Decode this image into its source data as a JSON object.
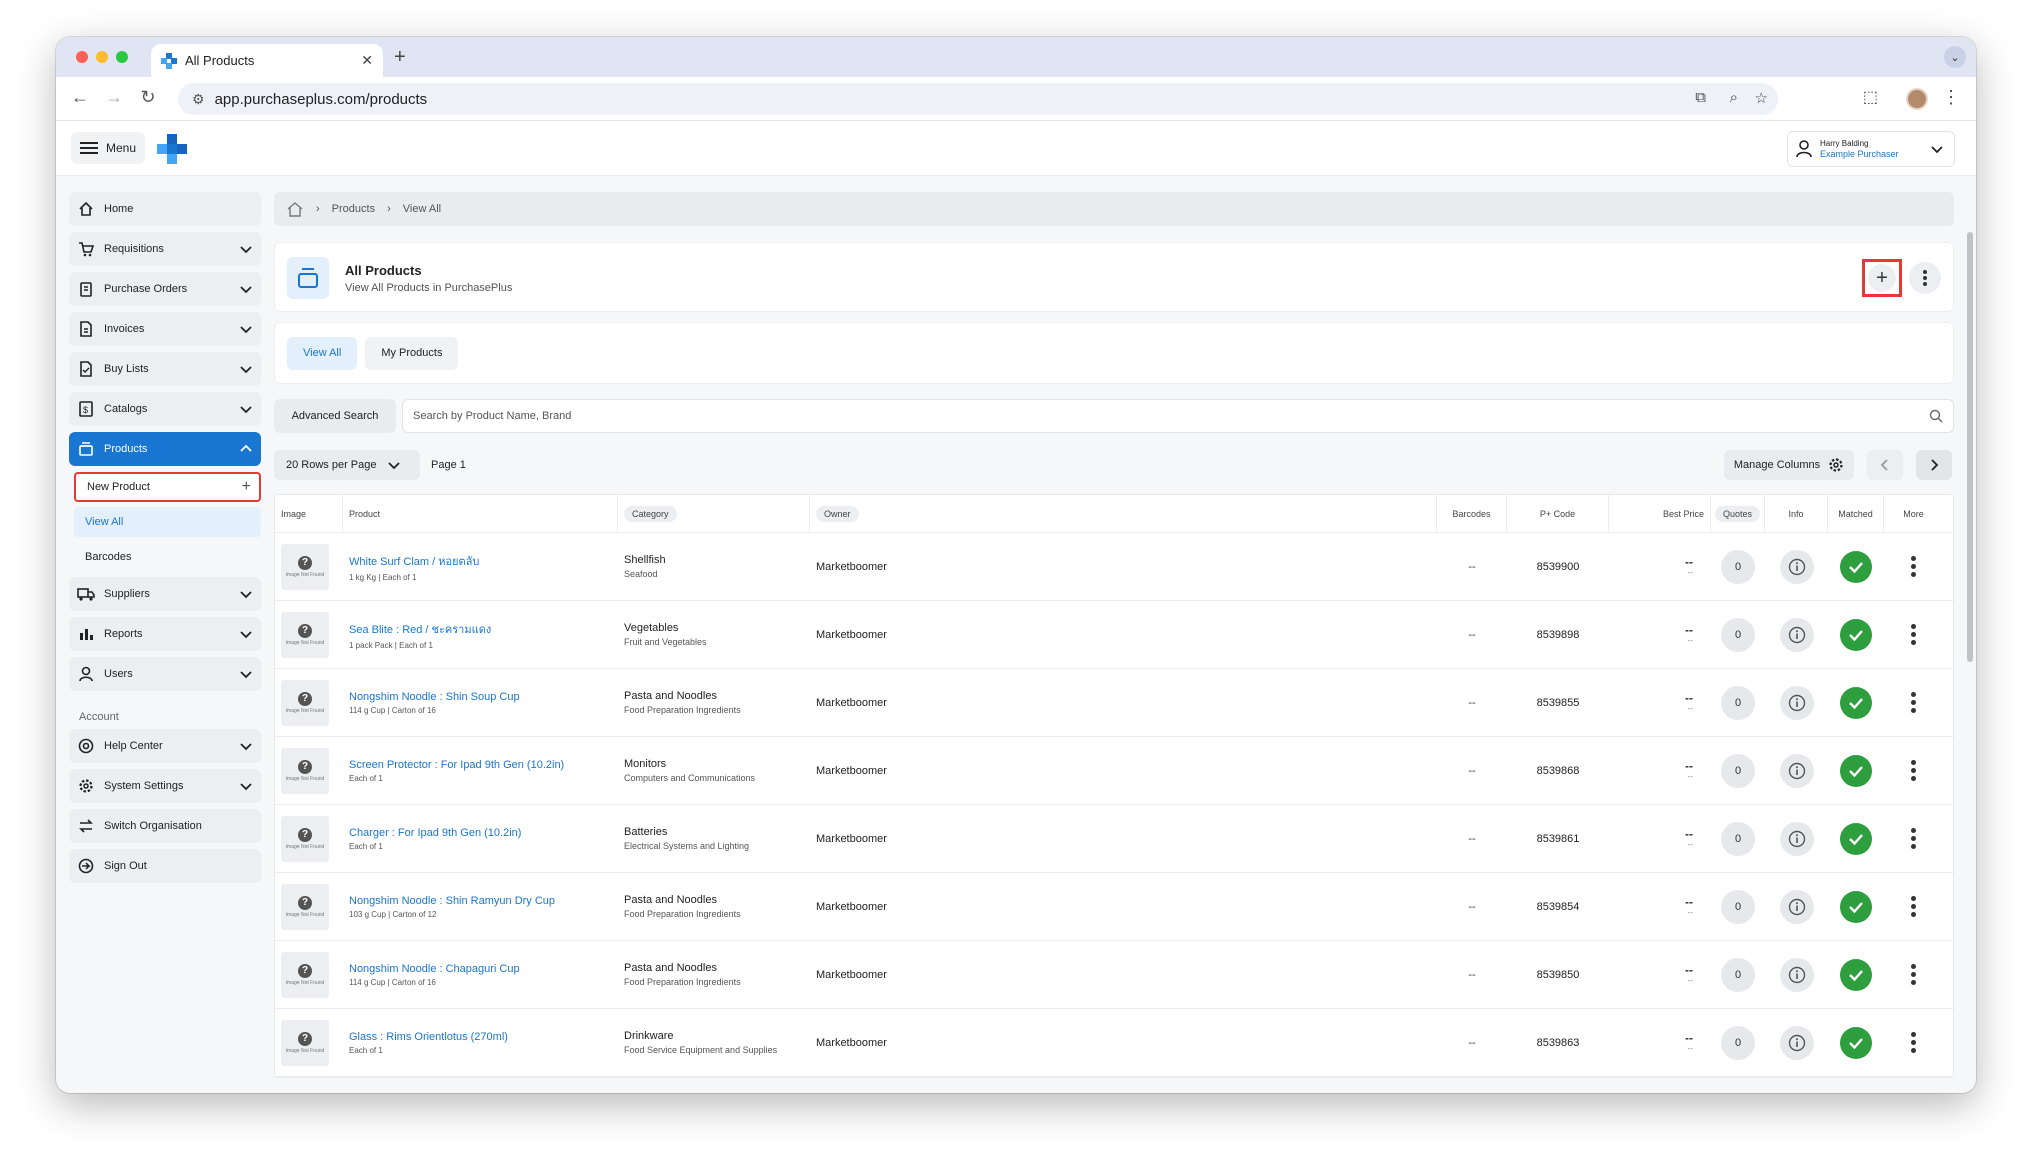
{
  "browser": {
    "tab_title": "All Products",
    "url": "app.purchaseplus.com/products",
    "colors": {
      "close": "#fe5f57",
      "minimize": "#febc2e",
      "maximize": "#28c840"
    }
  },
  "topbar": {
    "menu_label": "Menu",
    "user_name": "Harry Balding",
    "user_role": "Example Purchaser"
  },
  "sidebar": {
    "items": [
      {
        "label": "Home",
        "icon": "home-icon"
      },
      {
        "label": "Requisitions",
        "icon": "cart-icon"
      },
      {
        "label": "Purchase Orders",
        "icon": "clipboard-icon"
      },
      {
        "label": "Invoices",
        "icon": "document-icon"
      },
      {
        "label": "Buy Lists",
        "icon": "checklist-icon"
      },
      {
        "label": "Catalogs",
        "icon": "catalog-icon"
      },
      {
        "label": "Products",
        "icon": "products-icon"
      }
    ],
    "sub_items": [
      "New Product",
      "View All",
      "Barcodes"
    ],
    "items2": [
      {
        "label": "Suppliers",
        "icon": "truck-icon"
      },
      {
        "label": "Reports",
        "icon": "chart-icon"
      },
      {
        "label": "Users",
        "icon": "user-icon"
      }
    ],
    "account_label": "Account",
    "account_items": [
      {
        "label": "Help Center",
        "icon": "lifebuoy-icon"
      },
      {
        "label": "System Settings",
        "icon": "gear-icon"
      },
      {
        "label": "Switch Organisation",
        "icon": "switch-icon"
      },
      {
        "label": "Sign Out",
        "icon": "signout-icon"
      }
    ]
  },
  "breadcrumb": {
    "items": [
      "Products",
      "View All"
    ]
  },
  "header": {
    "title": "All Products",
    "subtitle": "View All Products in PurchasePlus"
  },
  "tabs": [
    "View All",
    "My Products"
  ],
  "search": {
    "advanced_label": "Advanced Search",
    "placeholder": "Search by Product Name, Brand"
  },
  "pager": {
    "rows_label": "20 Rows per Page",
    "page_label": "Page 1",
    "manage_label": "Manage Columns"
  },
  "table": {
    "columns": [
      "Image",
      "Product",
      "Category",
      "Owner",
      "Barcodes",
      "P+ Code",
      "Best Price",
      "Quotes",
      "Info",
      "Matched",
      "More"
    ],
    "image_placeholder": "Image Not Found",
    "rows": [
      {
        "name": "White Surf Clam / หอยตลับ",
        "detail": "1 kg Kg | Each of 1",
        "category": "Shellfish",
        "parent": "Seafood",
        "owner": "Marketboomer",
        "barcodes": "--",
        "code": "8539900",
        "price": "--",
        "price_sub": "--",
        "quotes": "0"
      },
      {
        "name": "Sea Blite : Red / ชะคราม​แดง",
        "detail": "1 pack Pack | Each of 1",
        "category": "Vegetables",
        "parent": "Fruit and Vegetables",
        "owner": "Marketboomer",
        "barcodes": "--",
        "code": "8539898",
        "price": "--",
        "price_sub": "--",
        "quotes": "0"
      },
      {
        "name": "Nongshim Noodle : Shin Soup Cup",
        "detail": "114 g Cup | Carton of 16",
        "category": "Pasta and Noodles",
        "parent": "Food Preparation Ingredients",
        "owner": "Marketboomer",
        "barcodes": "--",
        "code": "8539855",
        "price": "--",
        "price_sub": "--",
        "quotes": "0"
      },
      {
        "name": "Screen Protector : For Ipad 9th Gen (10.2in)",
        "detail": "Each of 1",
        "category": "Monitors",
        "parent": "Computers and Communications",
        "owner": "Marketboomer",
        "barcodes": "--",
        "code": "8539868",
        "price": "--",
        "price_sub": "--",
        "quotes": "0"
      },
      {
        "name": "Charger : For Ipad 9th Gen (10.2in)",
        "detail": "Each of 1",
        "category": "Batteries",
        "parent": "Electrical Systems and Lighting",
        "owner": "Marketboomer",
        "barcodes": "--",
        "code": "8539861",
        "price": "--",
        "price_sub": "--",
        "quotes": "0"
      },
      {
        "name": "Nongshim Noodle : Shin Ramyun Dry Cup",
        "detail": "103 g Cup | Carton of 12",
        "category": "Pasta and Noodles",
        "parent": "Food Preparation Ingredients",
        "owner": "Marketboomer",
        "barcodes": "--",
        "code": "8539854",
        "price": "--",
        "price_sub": "--",
        "quotes": "0"
      },
      {
        "name": "Nongshim Noodle : Chapaguri Cup",
        "detail": "114 g Cup | Carton of 16",
        "category": "Pasta and Noodles",
        "parent": "Food Preparation Ingredients",
        "owner": "Marketboomer",
        "barcodes": "--",
        "code": "8539850",
        "price": "--",
        "price_sub": "--",
        "quotes": "0"
      },
      {
        "name": "Glass : Rims Orientlotus (270ml)",
        "detail": "Each of 1",
        "category": "Drinkware",
        "parent": "Food Service Equipment and Supplies",
        "owner": "Marketboomer",
        "barcodes": "--",
        "code": "8539863",
        "price": "--",
        "price_sub": "--",
        "quotes": "0"
      }
    ]
  },
  "colors": {
    "accent": "#1976d2",
    "highlight": "#e53935",
    "matched": "#2e9e3f"
  }
}
